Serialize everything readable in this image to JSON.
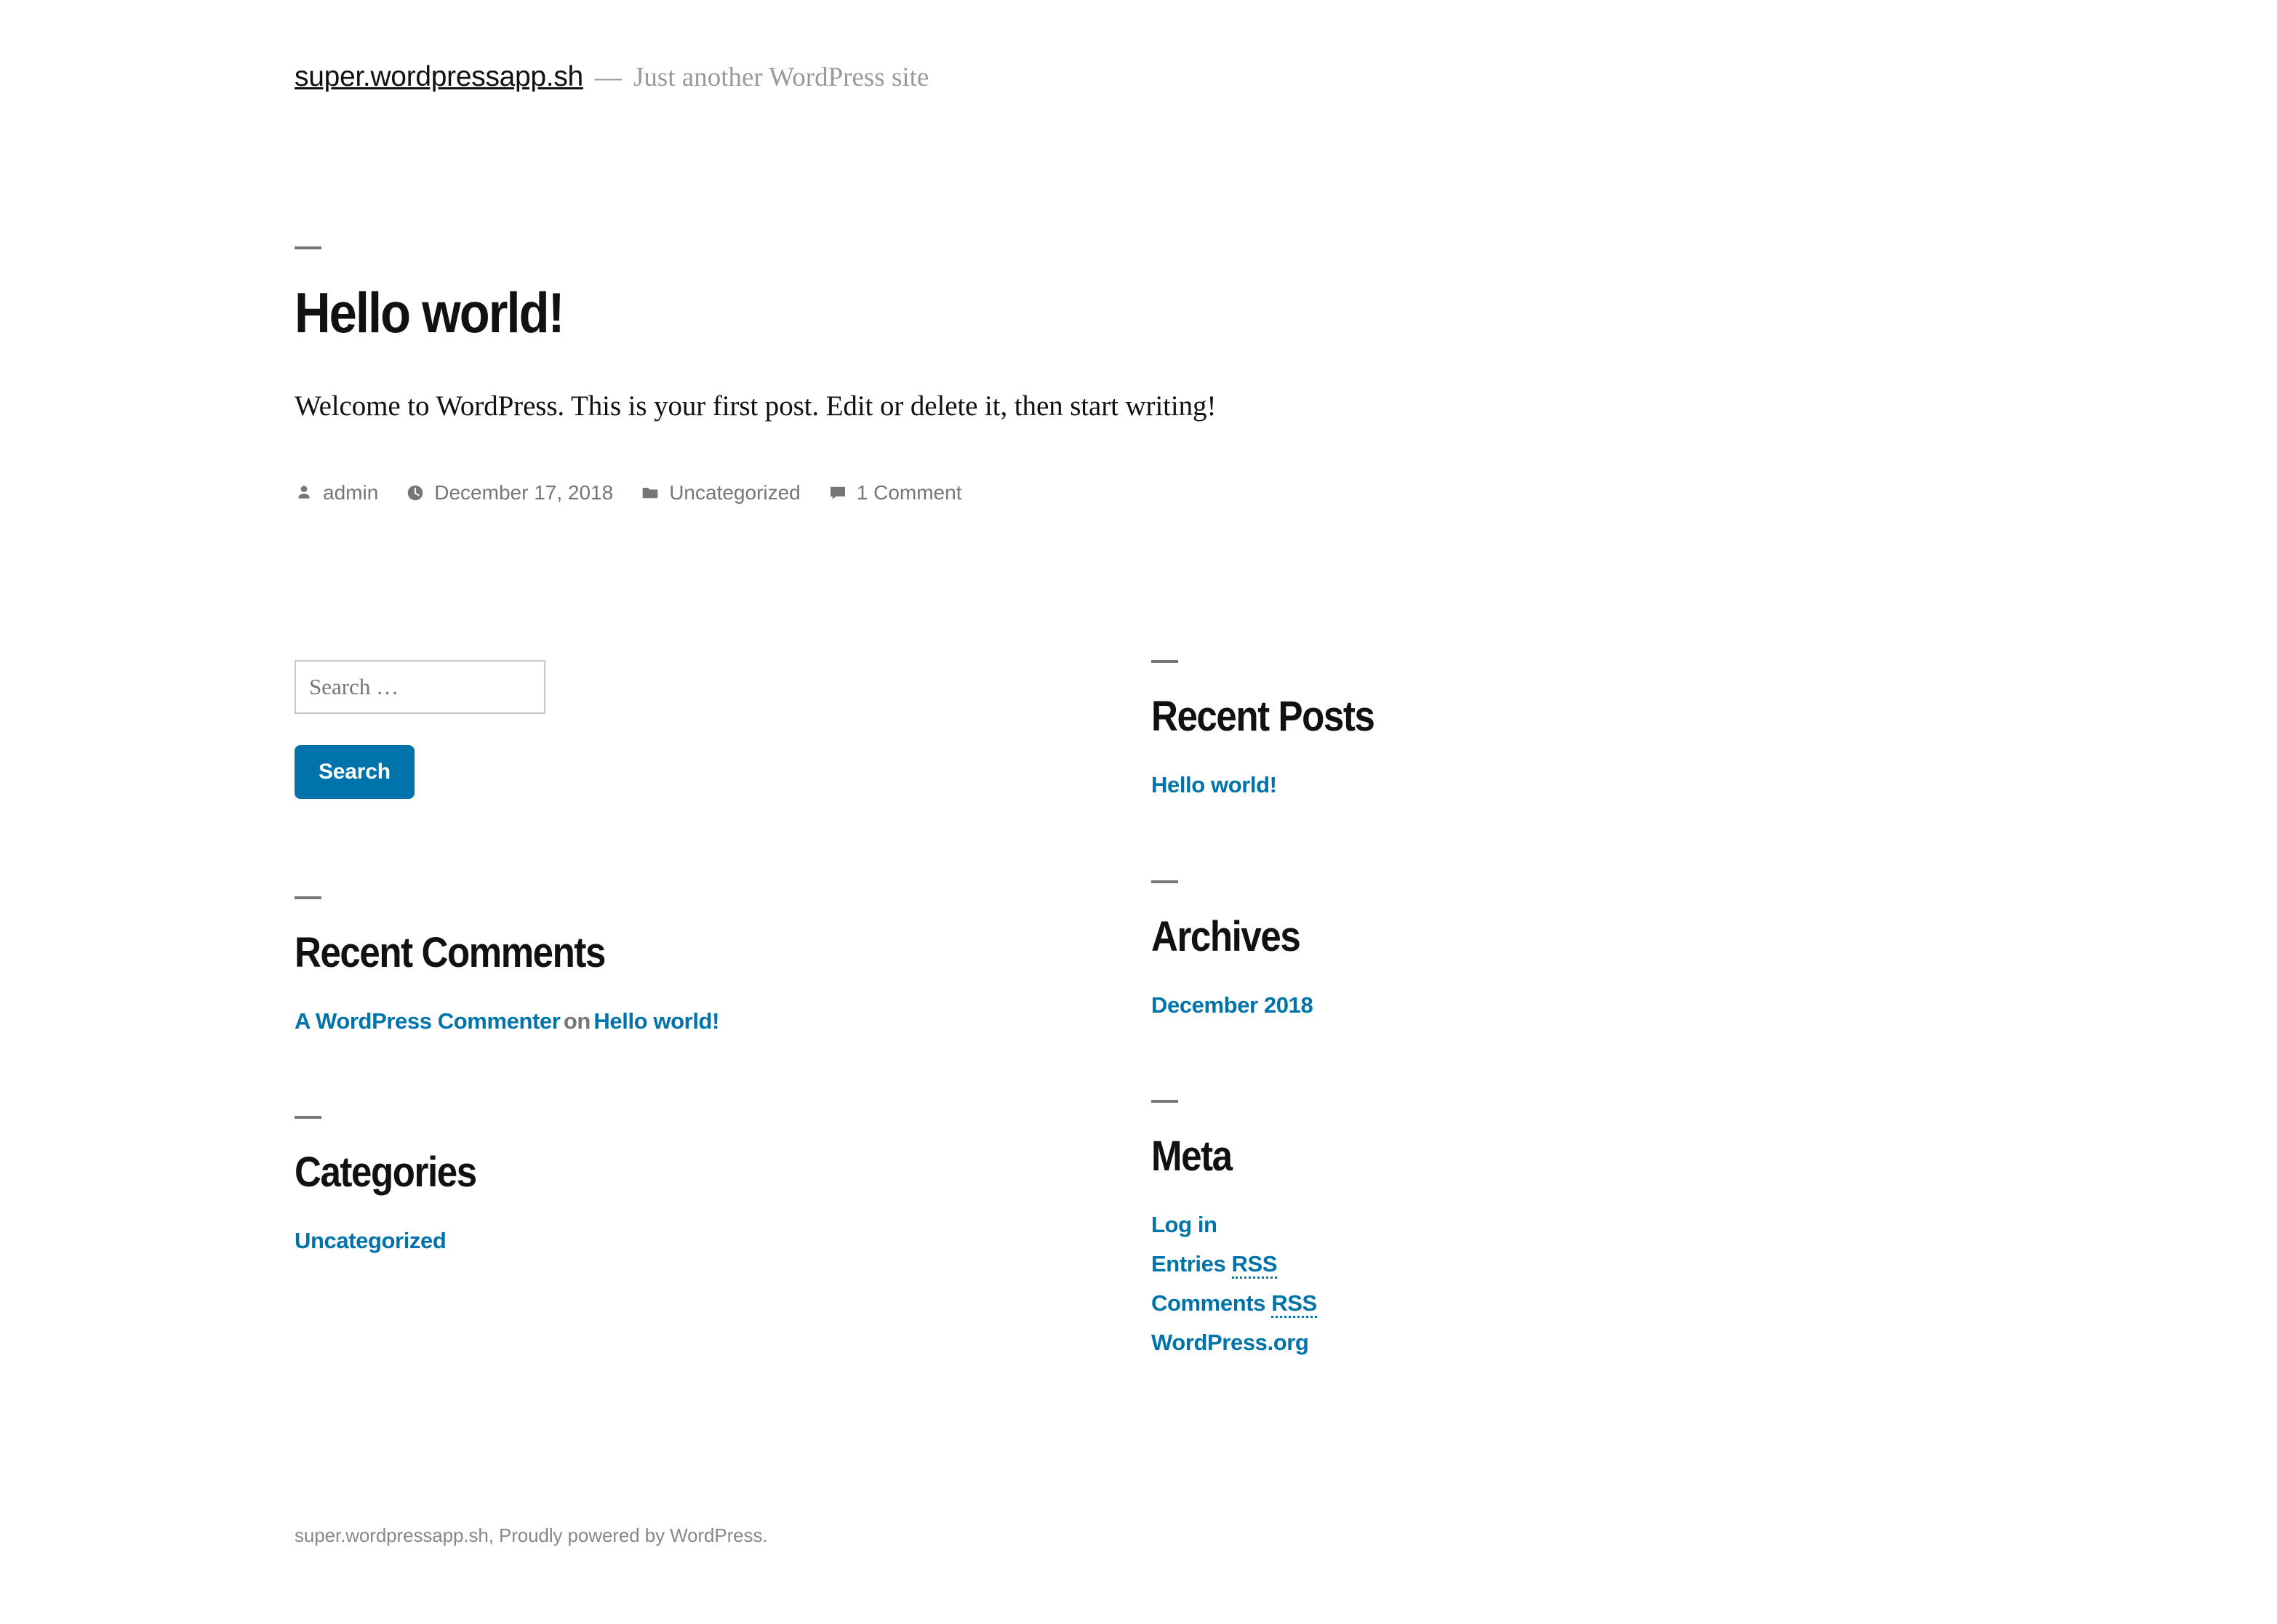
{
  "header": {
    "site_title": "super.wordpressapp.sh",
    "separator": "—",
    "site_description": "Just another WordPress site"
  },
  "post": {
    "title": "Hello world!",
    "body": "Welcome to WordPress. This is your first post. Edit or delete it, then start writing!",
    "meta": {
      "author": "admin",
      "date": "December 17, 2018",
      "category": "Uncategorized",
      "comments": "1 Comment"
    }
  },
  "search": {
    "placeholder": "Search …",
    "value": "",
    "button_label": "Search"
  },
  "widgets": {
    "recent_posts": {
      "title": "Recent Posts",
      "items": [
        {
          "label": "Hello world!"
        }
      ]
    },
    "recent_comments": {
      "title": "Recent Comments",
      "items": [
        {
          "author": "A WordPress Commenter",
          "connector": "on",
          "post": "Hello world!"
        }
      ]
    },
    "archives": {
      "title": "Archives",
      "items": [
        {
          "label": "December 2018"
        }
      ]
    },
    "categories": {
      "title": "Categories",
      "items": [
        {
          "label": "Uncategorized"
        }
      ]
    },
    "meta": {
      "title": "Meta",
      "items": [
        {
          "label": "Log in",
          "abbr": ""
        },
        {
          "label": "Entries ",
          "abbr": "RSS"
        },
        {
          "label": "Comments ",
          "abbr": "RSS"
        },
        {
          "label": "WordPress.org",
          "abbr": ""
        }
      ]
    }
  },
  "footer": {
    "text": "super.wordpressapp.sh, Proudly powered by WordPress."
  },
  "colors": {
    "link": "#0073aa",
    "button": "#0073aa",
    "muted": "#767676",
    "text": "#111111"
  }
}
